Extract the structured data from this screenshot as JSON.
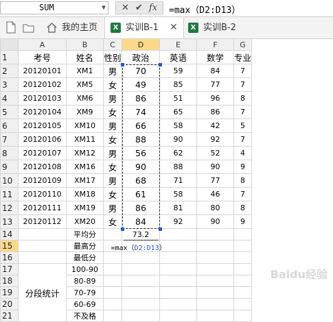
{
  "formula_bar": {
    "name_box": "SUM",
    "cancel_glyph": "✕",
    "enter_glyph": "✔",
    "fx_glyph": "fx",
    "formula": "=max（D2:D13）"
  },
  "tabs": [
    {
      "label": "我的主页",
      "icon": "home-icon"
    },
    {
      "label": "实训B-1",
      "icon": "excel-icon",
      "active": true,
      "closable": true
    },
    {
      "label": "实训B-2",
      "icon": "excel-icon"
    }
  ],
  "columns": [
    "A",
    "B",
    "C",
    "D",
    "E",
    "F",
    "G"
  ],
  "row_numbers": [
    "1",
    "2",
    "3",
    "4",
    "5",
    "6",
    "7",
    "8",
    "9",
    "10",
    "11",
    "12",
    "13",
    "14",
    "15",
    "16",
    "17",
    "18",
    "19",
    "20",
    "21"
  ],
  "table": {
    "headers": [
      "考号",
      "姓名",
      "性别",
      "政治",
      "英语",
      "数学",
      "专业"
    ],
    "rows": [
      [
        "20120101",
        "XM1",
        "男",
        "70",
        "59",
        "84",
        "7"
      ],
      [
        "20120102",
        "XM5",
        "女",
        "49",
        "85",
        "77",
        "7"
      ],
      [
        "20120103",
        "XM6",
        "男",
        "86",
        "51",
        "96",
        "8"
      ],
      [
        "20120104",
        "XM9",
        "女",
        "74",
        "65",
        "86",
        "7"
      ],
      [
        "20120105",
        "XM10",
        "男",
        "66",
        "58",
        "42",
        "5"
      ],
      [
        "20120106",
        "XM11",
        "女",
        "88",
        "90",
        "92",
        "7"
      ],
      [
        "20120107",
        "XM12",
        "男",
        "56",
        "62",
        "52",
        "4"
      ],
      [
        "20120108",
        "XM16",
        "女",
        "90",
        "88",
        "90",
        "9"
      ],
      [
        "20120109",
        "XM17",
        "男",
        "68",
        "71",
        "77",
        "8"
      ],
      [
        "20120110",
        "XM18",
        "女",
        "61",
        "58",
        "46",
        "7"
      ],
      [
        "20120111",
        "XM19",
        "男",
        "86",
        "81",
        "80",
        "8"
      ],
      [
        "20120112",
        "XM20",
        "女",
        "84",
        "92",
        "90",
        "9"
      ]
    ]
  },
  "stats": {
    "avg_label": "平均分",
    "avg_value": "73.2",
    "max_label": "最高分",
    "max_formula_prefix": "=max（",
    "max_formula_ref": "D2:D13",
    "max_formula_suffix": "）",
    "min_label": "最低分",
    "segment_label": "分段统计",
    "ranges": [
      "100-90",
      "80-89",
      "70-79",
      "60-69",
      "不及格"
    ]
  },
  "watermark": "Baidu经验",
  "colors": {
    "selected_header": "#fcd98a",
    "excel_green": "#1f7a3f",
    "ref_blue": "#1a4fd8"
  }
}
